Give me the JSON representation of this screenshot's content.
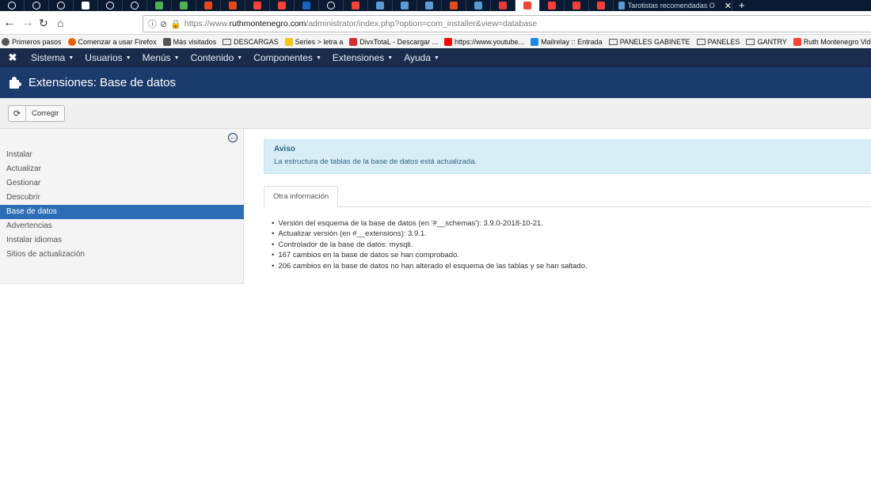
{
  "browser": {
    "tabs": [
      {
        "icon": "globe-icon",
        "color": "#ffffff"
      },
      {
        "icon": "globe-icon",
        "color": "#ffffff"
      },
      {
        "icon": "globe-icon",
        "color": "#ffffff"
      },
      {
        "icon": "feather-icon",
        "color": "#ffffff"
      },
      {
        "icon": "globe-icon",
        "color": "#ffffff"
      },
      {
        "icon": "globe-icon",
        "color": "#ffffff"
      },
      {
        "icon": "sheet-icon",
        "color": "#4caf50"
      },
      {
        "icon": "sheet-icon",
        "color": "#4caf50"
      },
      {
        "icon": "slides-icon",
        "color": "#e64a19"
      },
      {
        "icon": "slides-icon",
        "color": "#e64a19"
      },
      {
        "icon": "joomla-icon",
        "color": "#f44336"
      },
      {
        "icon": "joomla-icon",
        "color": "#f44336"
      },
      {
        "icon": "doc-icon",
        "color": "#1565c0"
      },
      {
        "icon": "globe-icon",
        "color": "#ffffff"
      },
      {
        "icon": "joomla-icon",
        "color": "#f44336"
      },
      {
        "icon": "ship-icon",
        "color": "#5b9bd5"
      },
      {
        "icon": "ship-icon",
        "color": "#5b9bd5"
      },
      {
        "icon": "ship-icon",
        "color": "#5b9bd5"
      },
      {
        "icon": "slides-icon",
        "color": "#e64a19"
      },
      {
        "icon": "ship-icon",
        "color": "#5b9bd5"
      },
      {
        "icon": "translate-icon",
        "color": "#e53935"
      },
      {
        "icon": "joomla-icon",
        "color": "#f44336",
        "active": true
      },
      {
        "icon": "joomla-icon",
        "color": "#f44336"
      },
      {
        "icon": "joomla-icon",
        "color": "#f44336"
      },
      {
        "icon": "joomla-icon",
        "color": "#f44336"
      }
    ],
    "last_tab_title": "Tarotistas recomendadas O",
    "url": {
      "prefix": "https://www.",
      "domain": "ruthmontenegro.com",
      "rest": "/administrator/index.php?option=com_installer&view=database"
    },
    "bookmarks": [
      {
        "label": "Primeros pasos",
        "icon": "globe-icon",
        "color": "#555555"
      },
      {
        "label": "Comenzar a usar Firefox",
        "icon": "firefox-icon",
        "color": "#e66000"
      },
      {
        "label": "Más visitados",
        "icon": "gear-icon",
        "color": "#555555"
      },
      {
        "label": "DESCARGAS",
        "icon": "folder-icon",
        "color": "#555555"
      },
      {
        "label": "Series > letra a",
        "icon": "emoji-icon",
        "color": "#f5c518"
      },
      {
        "label": "DivxTotaL - Descargar ...",
        "icon": "divx-icon",
        "color": "#d32f2f"
      },
      {
        "label": "https://www.youtube...",
        "icon": "youtube-icon",
        "color": "#ff0000"
      },
      {
        "label": "Mailrelay :: Entrada",
        "icon": "mail-icon",
        "color": "#1e88e5"
      },
      {
        "label": "PANELES GABINETE",
        "icon": "folder-icon",
        "color": "#555555"
      },
      {
        "label": "PANELES",
        "icon": "folder-icon",
        "color": "#555555"
      },
      {
        "label": "GANTRY",
        "icon": "folder-icon",
        "color": "#555555"
      },
      {
        "label": "Ruth Montenegro Vid...",
        "icon": "joomla-icon",
        "color": "#f44336"
      }
    ]
  },
  "joomla": {
    "menu": [
      "Sistema",
      "Usuarios",
      "Menús",
      "Contenido",
      "Componentes",
      "Extensiones",
      "Ayuda"
    ],
    "page_title": "Extensiones: Base de datos",
    "toolbar": {
      "fix_label": "Corregir"
    },
    "sidebar": {
      "items": [
        "Instalar",
        "Actualizar",
        "Gestionar",
        "Descubrir",
        "Base de datos",
        "Advertencias",
        "Instalar idiomas",
        "Sitios de actualización"
      ],
      "active_index": 4
    },
    "alert": {
      "heading": "Aviso",
      "message": "La estructura de tablas de la base de datos está actualizada."
    },
    "tab_label": "Otra información",
    "info": [
      "Versión del esquema de la base de datos (en '#__schemas'): 3.9.0-2018-10-21.",
      "Actualizar versión (en #__extensions): 3.9.1.",
      "Controlador de la base de datos: mysqli.",
      "167 cambios en la base de datos se han comprobado.",
      "206 cambios en la base de datos no han alterado el esquema de las tablas y se han saltado."
    ]
  },
  "colors": {
    "topmenu_bg": "#1a2b4c",
    "header_bg": "#1b3b6c",
    "active_item": "#2d6db5",
    "alert_bg": "#d9edf7"
  }
}
